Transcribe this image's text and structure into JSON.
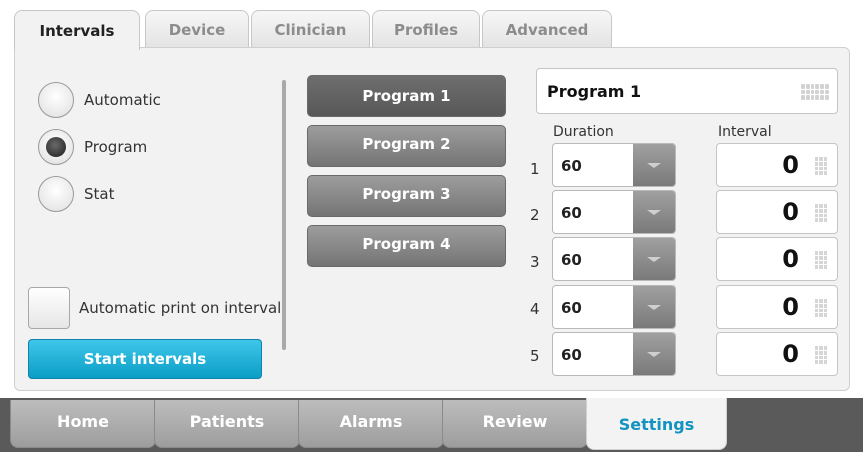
{
  "top_tabs": [
    "Intervals",
    "Device",
    "Clinician",
    "Profiles",
    "Advanced"
  ],
  "mode": {
    "options": [
      "Automatic",
      "Program",
      "Stat"
    ],
    "selected": "Program"
  },
  "auto_print": {
    "label": "Automatic print on interval",
    "checked": false
  },
  "start_button": "Start intervals",
  "programs": [
    "Program 1",
    "Program 2",
    "Program 3",
    "Program 4"
  ],
  "selected_program": "Program 1",
  "program_name": "Program 1",
  "columns": {
    "duration": "Duration",
    "interval": "Interval"
  },
  "rows": [
    {
      "num": "1",
      "duration": "60",
      "interval": "0"
    },
    {
      "num": "2",
      "duration": "60",
      "interval": "0"
    },
    {
      "num": "3",
      "duration": "60",
      "interval": "0"
    },
    {
      "num": "4",
      "duration": "60",
      "interval": "0"
    },
    {
      "num": "5",
      "duration": "60",
      "interval": "0"
    }
  ],
  "bottom_nav": [
    "Home",
    "Patients",
    "Alarms",
    "Review",
    "Settings"
  ],
  "active_nav": "Settings",
  "colors": {
    "accent": "#1393c0",
    "start_button": "#1aaed6"
  }
}
